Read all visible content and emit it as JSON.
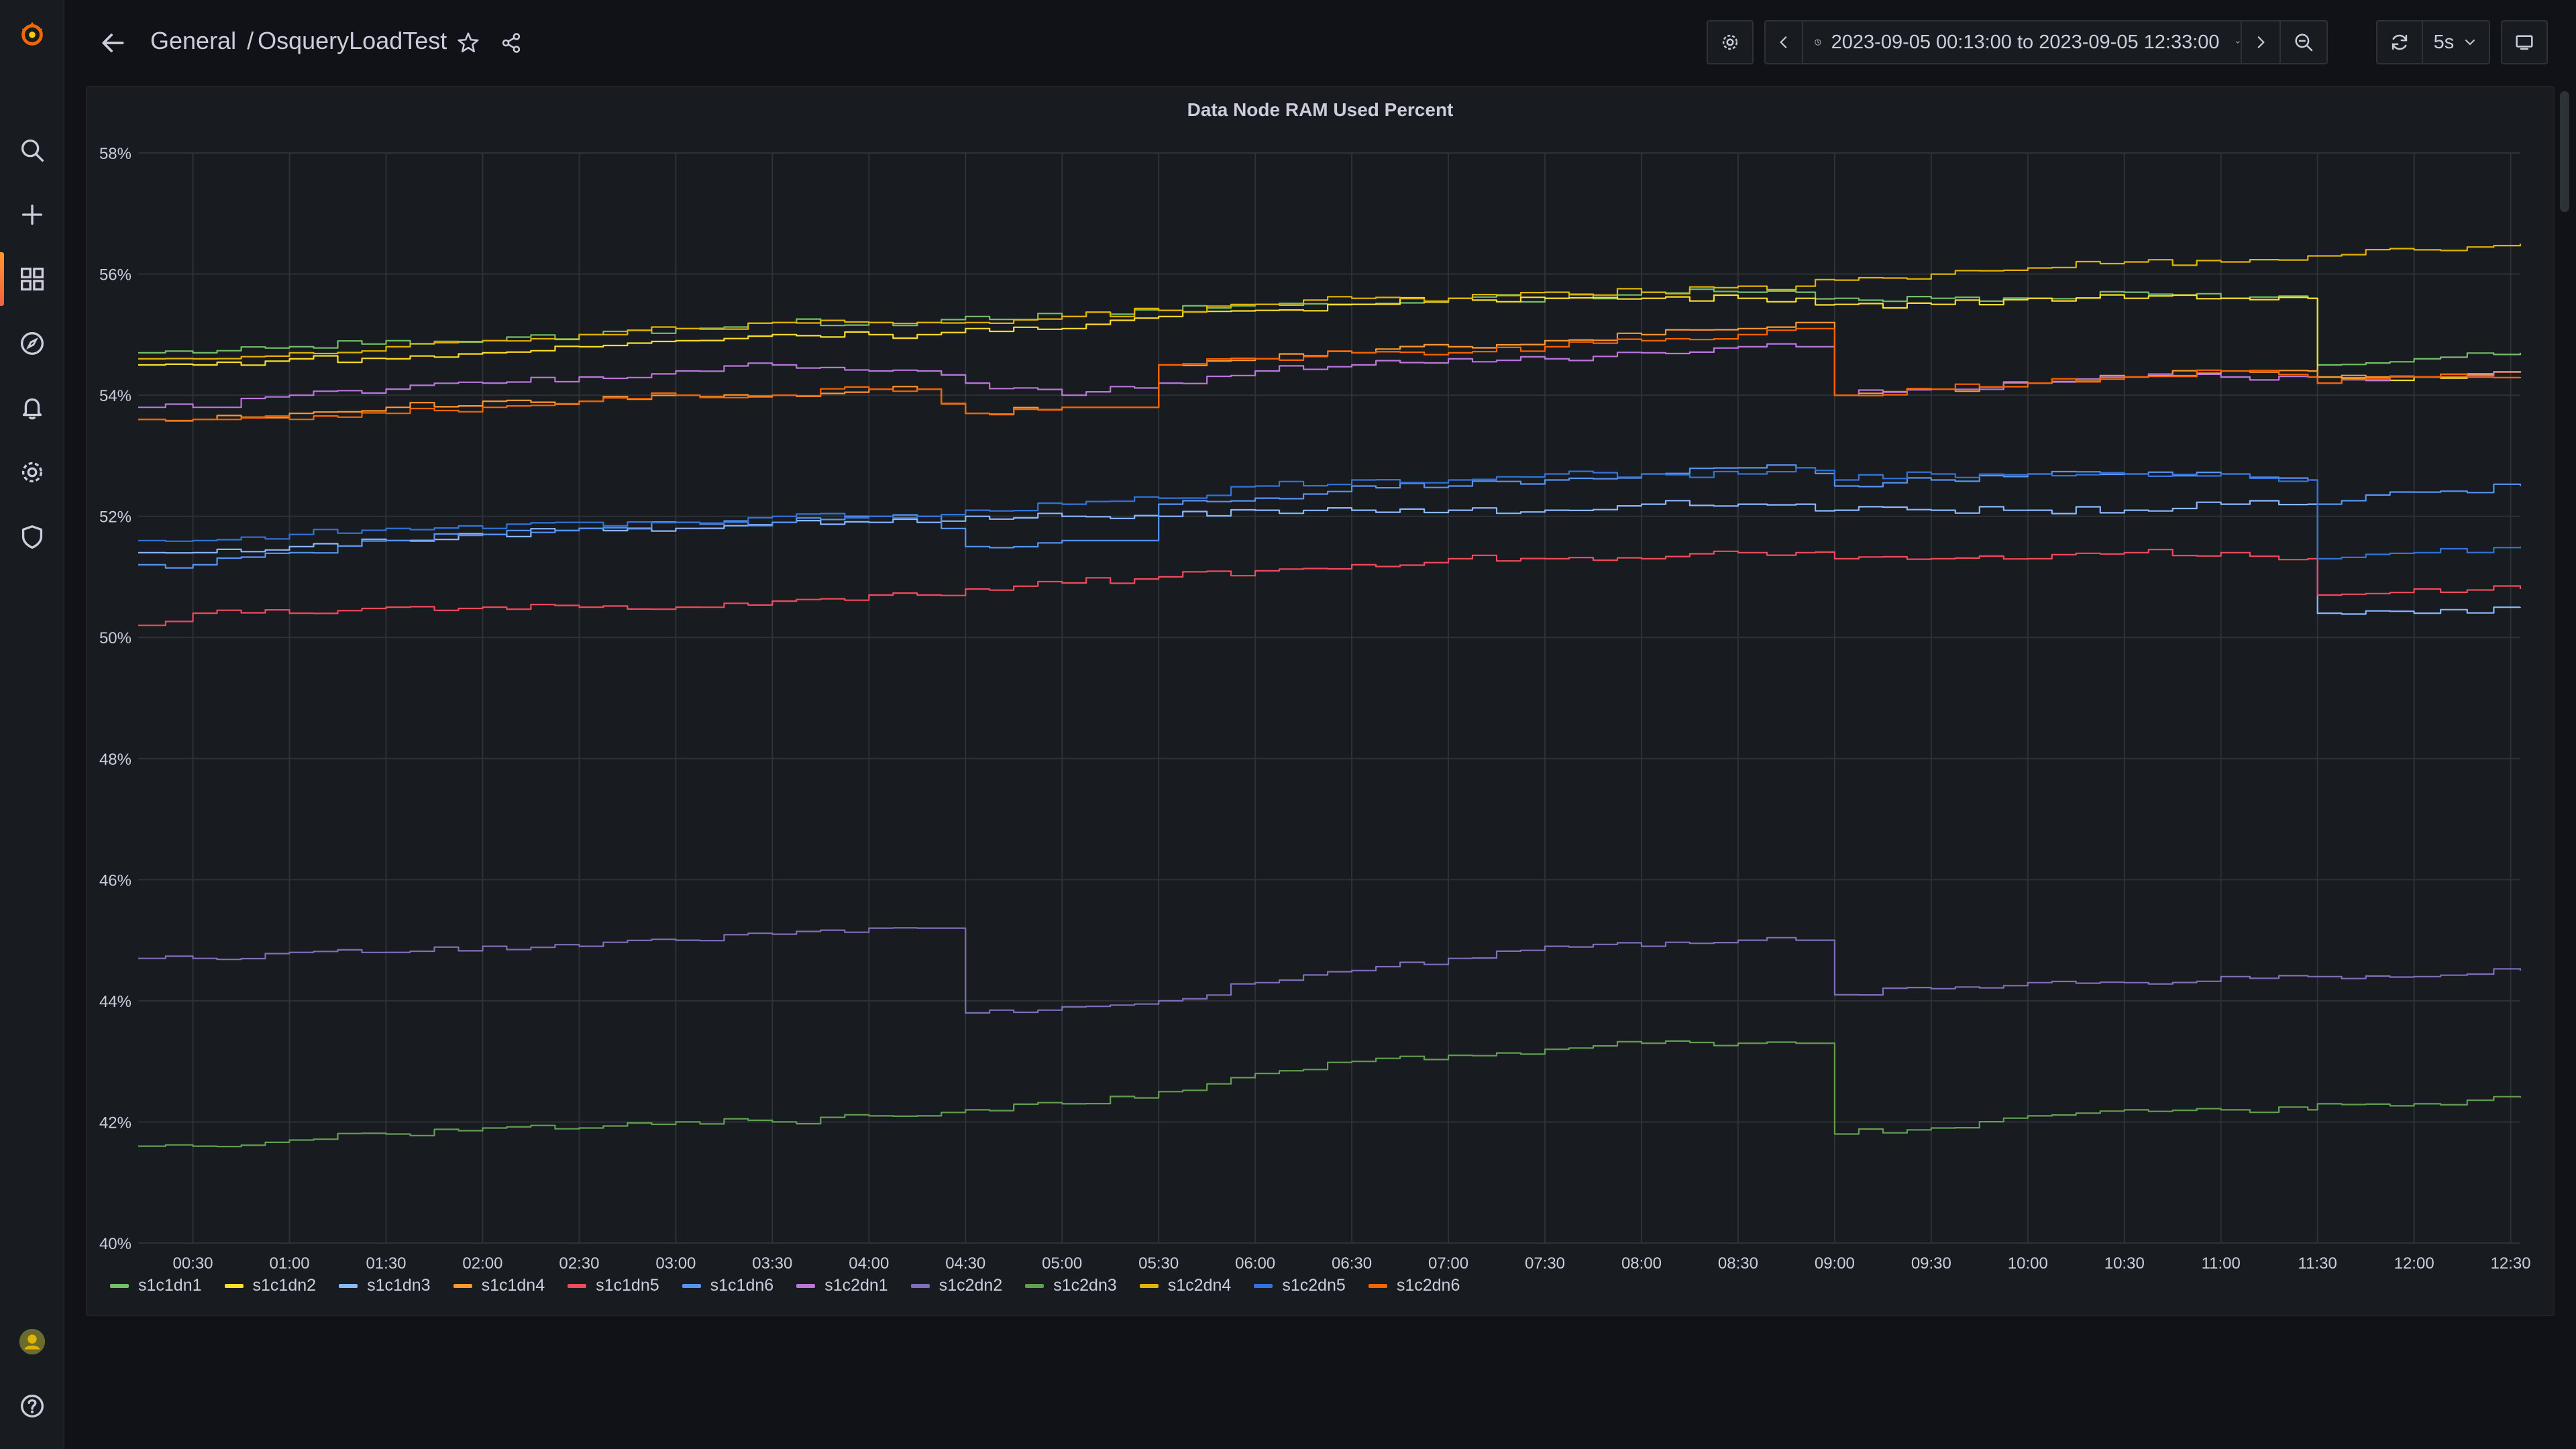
{
  "breadcrumb": {
    "folder": "General",
    "separator": "/",
    "dashboard": "OsqueryLoadTest"
  },
  "toolbar": {
    "time_range": "2023-09-05 00:13:00 to 2023-09-05 12:33:00",
    "refresh_interval": "5s"
  },
  "icons": {
    "sidebar": [
      "grafana-logo-icon",
      "search-icon",
      "plus-icon",
      "dashboards-icon",
      "explore-icon",
      "alerting-icon",
      "gear-icon",
      "shield-icon",
      "avatar",
      "help-icon"
    ],
    "toolbar": [
      "back-arrow-icon",
      "star-icon",
      "share-icon",
      "gear-icon",
      "chevron-left-icon",
      "clock-icon",
      "chevron-down-icon",
      "chevron-right-icon",
      "zoom-out-icon",
      "refresh-icon",
      "tv-icon"
    ]
  },
  "colors": {
    "accent": "#f55f3e",
    "background": "#111217",
    "panel": "#181b1f",
    "grid": "#2c3235"
  },
  "panel": {
    "title": "Data Node RAM Used Percent"
  },
  "chart_data": {
    "type": "line",
    "title": "Data Node RAM Used Percent",
    "xlabel": "",
    "ylabel": "",
    "ylim": [
      40,
      58
    ],
    "y_ticks": [
      "40%",
      "42%",
      "44%",
      "46%",
      "48%",
      "50%",
      "52%",
      "54%",
      "56%",
      "58%"
    ],
    "x_ticks": [
      "00:30",
      "01:00",
      "01:30",
      "02:00",
      "02:30",
      "03:00",
      "03:30",
      "04:00",
      "04:30",
      "05:00",
      "05:30",
      "06:00",
      "06:30",
      "07:00",
      "07:30",
      "08:00",
      "08:30",
      "09:00",
      "09:30",
      "10:00",
      "10:30",
      "11:00",
      "11:30",
      "12:00",
      "12:30"
    ],
    "x": [
      "00:13",
      "00:30",
      "01:00",
      "01:30",
      "02:00",
      "02:30",
      "03:00",
      "03:30",
      "04:00",
      "04:15",
      "04:30",
      "05:00",
      "05:30",
      "06:00",
      "06:30",
      "07:00",
      "07:30",
      "08:00",
      "08:30",
      "08:48",
      "09:00",
      "09:30",
      "10:00",
      "10:30",
      "11:00",
      "11:27",
      "11:30",
      "12:00",
      "12:33"
    ],
    "grid": true,
    "legend_position": "bottom-left",
    "series": [
      {
        "name": "s1c1dn1",
        "color": "#73bf69",
        "values": [
          54.7,
          54.7,
          54.8,
          54.9,
          54.9,
          55.0,
          55.1,
          55.2,
          55.2,
          55.2,
          55.3,
          55.3,
          55.4,
          55.5,
          55.5,
          55.6,
          55.6,
          55.7,
          55.7,
          55.7,
          55.6,
          55.6,
          55.6,
          55.7,
          55.6,
          55.6,
          54.5,
          54.6,
          54.7
        ]
      },
      {
        "name": "s1c1dn2",
        "color": "#fade2a",
        "values": [
          54.5,
          54.5,
          54.6,
          54.6,
          54.7,
          54.8,
          54.9,
          55.0,
          55.0,
          55.0,
          55.1,
          55.1,
          55.3,
          55.4,
          55.5,
          55.6,
          55.6,
          55.6,
          55.6,
          55.6,
          55.5,
          55.5,
          55.6,
          55.6,
          55.6,
          55.6,
          54.3,
          54.3,
          54.4
        ]
      },
      {
        "name": "s1c1dn3",
        "color": "#8ab8ff",
        "values": [
          51.4,
          51.4,
          51.5,
          51.6,
          51.7,
          51.8,
          51.8,
          51.9,
          51.9,
          51.9,
          52.0,
          52.0,
          52.0,
          52.1,
          52.1,
          52.1,
          52.1,
          52.2,
          52.2,
          52.2,
          52.1,
          52.1,
          52.1,
          52.1,
          52.2,
          52.2,
          50.4,
          50.4,
          50.5
        ]
      },
      {
        "name": "s1c1dn4",
        "color": "#ff9830",
        "values": [
          53.6,
          53.6,
          53.7,
          53.8,
          53.9,
          53.9,
          54.0,
          54.0,
          54.1,
          54.1,
          53.7,
          53.8,
          54.5,
          54.6,
          54.7,
          54.8,
          54.9,
          55.0,
          55.1,
          55.2,
          54.0,
          54.1,
          54.2,
          54.3,
          54.4,
          54.4,
          54.3,
          54.3,
          54.4
        ]
      },
      {
        "name": "s1c1dn5",
        "color": "#f2495c",
        "values": [
          50.2,
          50.4,
          50.4,
          50.5,
          50.5,
          50.5,
          50.5,
          50.6,
          50.7,
          50.7,
          50.8,
          50.9,
          51.0,
          51.1,
          51.2,
          51.3,
          51.3,
          51.3,
          51.4,
          51.4,
          51.3,
          51.3,
          51.3,
          51.4,
          51.4,
          51.3,
          50.7,
          50.8,
          50.8
        ]
      },
      {
        "name": "s1c1dn6",
        "color": "#5794f2",
        "values": [
          51.2,
          51.2,
          51.4,
          51.6,
          51.7,
          51.8,
          51.9,
          51.9,
          52.0,
          52.0,
          51.5,
          51.6,
          52.2,
          52.3,
          52.5,
          52.5,
          52.6,
          52.7,
          52.8,
          52.8,
          52.5,
          52.6,
          52.7,
          52.7,
          52.7,
          52.6,
          52.2,
          52.4,
          52.5
        ]
      },
      {
        "name": "s1c2dn1",
        "color": "#b877d9",
        "values": [
          53.8,
          53.8,
          54.0,
          54.1,
          54.2,
          54.3,
          54.4,
          54.5,
          54.4,
          54.4,
          54.2,
          54.0,
          54.2,
          54.4,
          54.5,
          54.6,
          54.6,
          54.7,
          54.8,
          54.8,
          54.0,
          54.1,
          54.2,
          54.3,
          54.3,
          54.3,
          54.2,
          54.3,
          54.4
        ]
      },
      {
        "name": "s1c2dn2",
        "color": "#806eb7",
        "values": [
          44.7,
          44.7,
          44.8,
          44.8,
          44.9,
          44.9,
          45.0,
          45.1,
          45.2,
          45.2,
          43.8,
          43.9,
          44.0,
          44.3,
          44.5,
          44.7,
          44.9,
          44.9,
          45.0,
          45.0,
          44.1,
          44.2,
          44.3,
          44.3,
          44.4,
          44.4,
          44.4,
          44.4,
          44.5
        ]
      },
      {
        "name": "s1c2dn3",
        "color": "#629e51",
        "values": [
          41.6,
          41.6,
          41.7,
          41.8,
          41.9,
          41.9,
          42.0,
          42.0,
          42.1,
          42.1,
          42.2,
          42.3,
          42.5,
          42.8,
          43.0,
          43.1,
          43.2,
          43.3,
          43.3,
          43.3,
          41.8,
          41.9,
          42.1,
          42.2,
          42.2,
          42.2,
          42.3,
          42.3,
          42.4
        ]
      },
      {
        "name": "s1c2dn4",
        "color": "#e0b400",
        "values": [
          54.6,
          54.6,
          54.7,
          54.8,
          54.9,
          55.0,
          55.1,
          55.2,
          55.2,
          55.2,
          55.2,
          55.3,
          55.4,
          55.5,
          55.6,
          55.6,
          55.7,
          55.7,
          55.8,
          55.8,
          55.9,
          56.0,
          56.1,
          56.2,
          56.2,
          56.3,
          56.3,
          56.4,
          56.5
        ]
      },
      {
        "name": "s1c2dn5",
        "color": "#3274d9",
        "values": [
          51.6,
          51.6,
          51.7,
          51.8,
          51.8,
          51.9,
          51.9,
          52.0,
          52.0,
          52.0,
          52.1,
          52.2,
          52.3,
          52.5,
          52.6,
          52.6,
          52.7,
          52.7,
          52.7,
          52.8,
          52.6,
          52.7,
          52.7,
          52.7,
          52.7,
          52.6,
          51.3,
          51.4,
          51.5
        ]
      },
      {
        "name": "s1c2dn6",
        "color": "#fa6400",
        "values": [
          53.6,
          53.6,
          53.6,
          53.7,
          53.8,
          53.9,
          54.0,
          54.0,
          54.1,
          54.1,
          53.7,
          53.8,
          54.5,
          54.6,
          54.7,
          54.7,
          54.8,
          54.9,
          55.0,
          55.1,
          54.0,
          54.1,
          54.2,
          54.3,
          54.4,
          54.3,
          54.2,
          54.3,
          54.3
        ]
      }
    ]
  }
}
